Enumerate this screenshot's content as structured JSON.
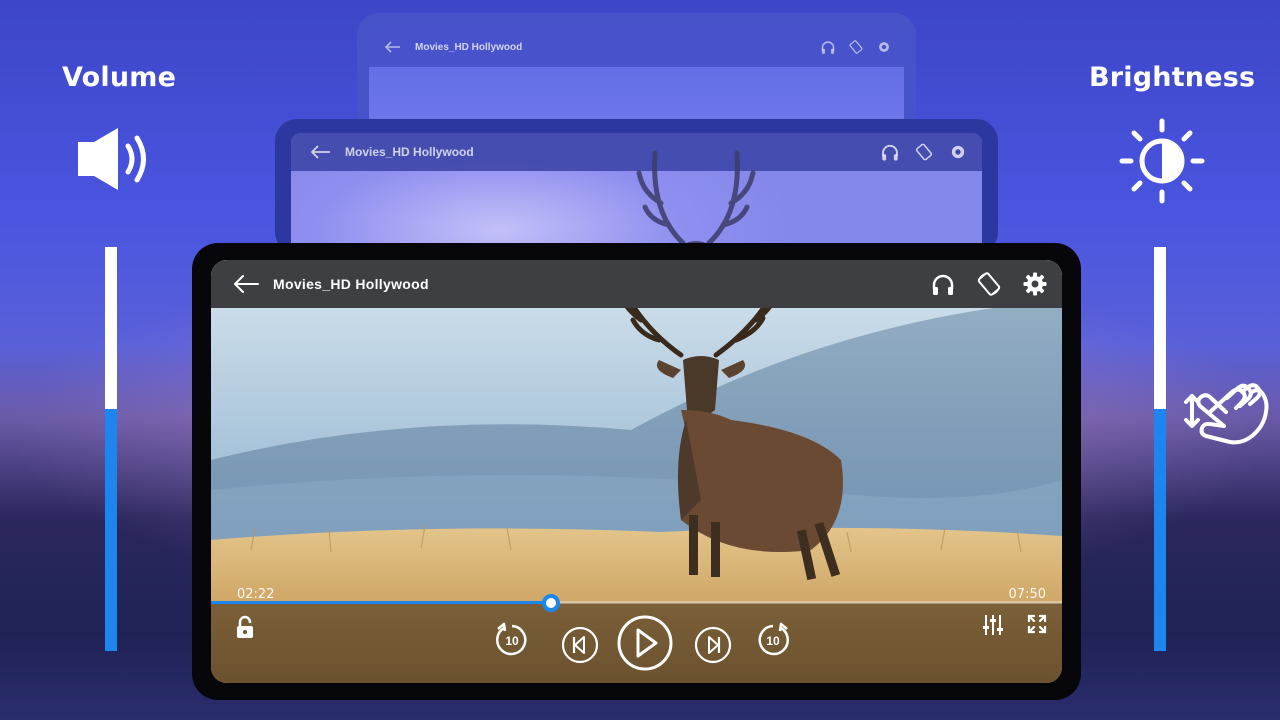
{
  "side": {
    "volume_label": "Volume",
    "brightness_label": "Brightness",
    "volume_level": 0.6,
    "brightness_level": 0.6
  },
  "player": {
    "title": "Movies_HD Hollywood",
    "current_time": "02:22",
    "total_time": "07:50",
    "progress": 0.4
  },
  "icons": {
    "back": "arrow-left-icon",
    "headphones": "headphones-icon",
    "rotate": "screen-rotate-icon",
    "settings": "gear-icon",
    "lock": "lock-icon",
    "rewind": "replay-10-icon",
    "previous": "skip-previous-icon",
    "play": "play-icon",
    "next": "skip-next-icon",
    "forward": "forward-10-icon",
    "equalizer": "equalizer-icon",
    "fullscreen": "fullscreen-icon",
    "volume": "speaker-icon",
    "brightness": "brightness-icon",
    "gesture": "swipe-hand-icon"
  },
  "colors": {
    "accent": "#1d86ee",
    "topbar": "#3d3f43"
  }
}
